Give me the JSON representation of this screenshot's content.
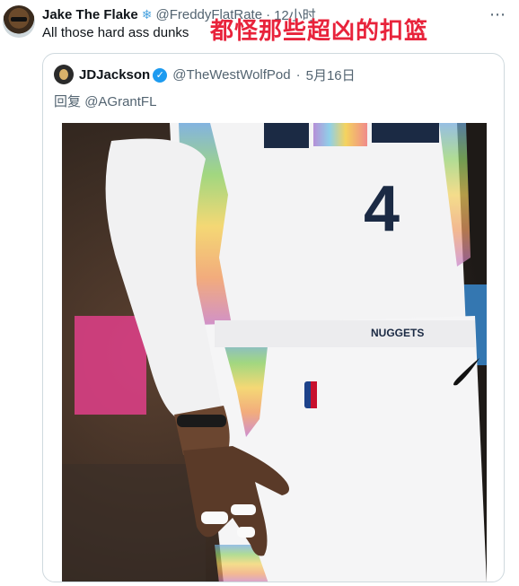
{
  "tweet": {
    "author_name": "Jake The Flake",
    "author_handle": "@FreddyFlatRate",
    "time": "12小时",
    "text": "All those hard ass dunks",
    "overlay_caption": "都怪那些超凶的扣篮"
  },
  "quoted": {
    "author_name": "JDJackson",
    "author_handle": "@TheWestWolfPod",
    "date": "5月16日",
    "reply_prefix": "回复",
    "reply_to": "@AGrantFL",
    "photo": {
      "jersey_number": "4",
      "waistband_text": "NUGGETS"
    }
  }
}
